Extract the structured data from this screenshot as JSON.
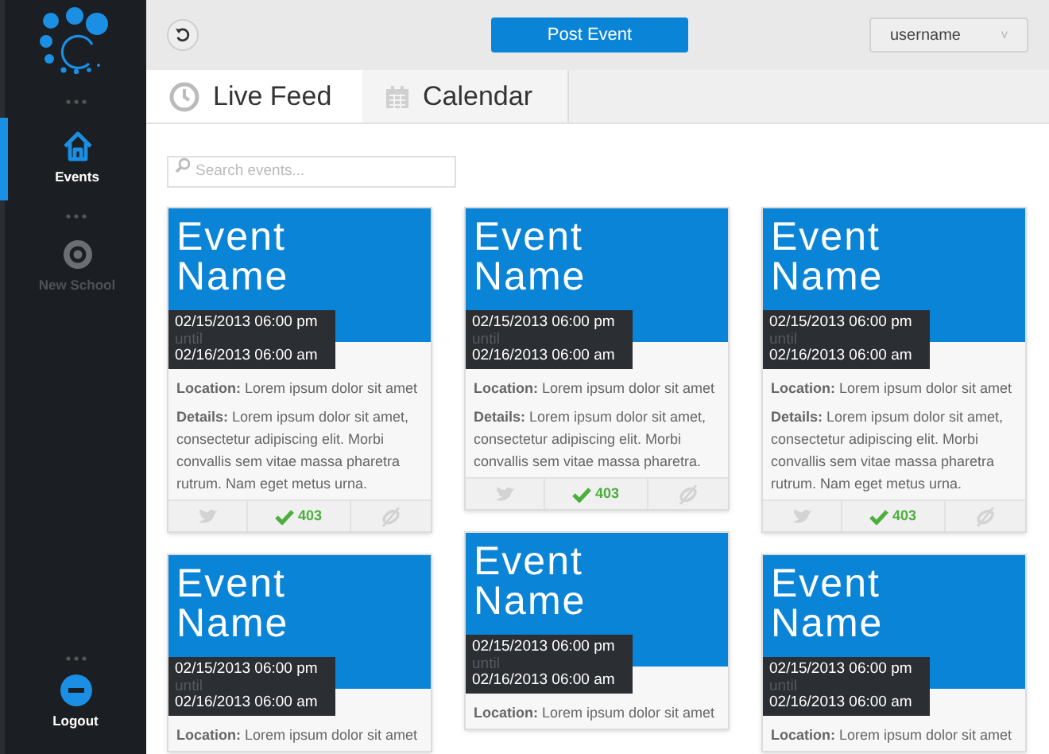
{
  "sidebar": {
    "items": [
      {
        "label": "Events",
        "kind": "home",
        "selected": true
      },
      {
        "label": "New School",
        "kind": "target",
        "selected": false
      }
    ],
    "footer_item": {
      "label": "Logout"
    }
  },
  "toolbar": {
    "post_button": "Post Event",
    "user_menu": {
      "value": "username",
      "caret": "v"
    }
  },
  "tabs": [
    {
      "label": "Live Feed",
      "kind": "clock",
      "selected": true
    },
    {
      "label": "Calendar",
      "kind": "calendar",
      "selected": false
    }
  ],
  "search": {
    "placeholder": "Search events..."
  },
  "columns": [
    {
      "cards": [
        {
          "title": "Event Name",
          "start": "02/15/2013 06:00 pm",
          "until": "until",
          "end": "02/16/2013 06:00 am",
          "body": [
            "**Location:** Lorem ipsum dolor sit amet",
            "**Details:** Lorem ipsum dolor sit amet, consectetur adipiscing elit. Morbi convallis sem vitae massa pharetra rutrum. Nam eget metus urna."
          ],
          "footer": {
            "count": "403",
            "checked": true
          }
        },
        {
          "title": "Event Name",
          "start": "02/15/2013 06:00 pm",
          "until": "until",
          "end": "02/16/2013 06:00 am",
          "body": [
            "**Location:** Lorem ipsum dolor sit amet"
          ]
        }
      ]
    },
    {
      "cards": [
        {
          "title": "Event Name",
          "start": "02/15/2013 06:00 pm",
          "until": "until",
          "end": "02/16/2013 06:00 am",
          "body": [
            "**Location:** Lorem ipsum dolor sit amet",
            "**Details:** Lorem ipsum dolor sit amet, consectetur adipiscing elit. Morbi convallis sem vitae massa pharetra."
          ],
          "footer": {
            "count": "403",
            "checked": true
          }
        },
        {
          "title": "Event Name",
          "start": "02/15/2013 06:00 pm",
          "until": "until",
          "end": "02/16/2013 06:00 am",
          "body": [
            "**Location:** Lorem ipsum dolor sit amet"
          ]
        }
      ]
    },
    {
      "cards": [
        {
          "title": "Event Name",
          "start": "02/15/2013 06:00 pm",
          "until": "until",
          "end": "02/16/2013 06:00 am",
          "body": [
            "**Location:** Lorem ipsum dolor sit amet",
            "**Details:** Lorem ipsum dolor sit amet, consectetur adipiscing elit. Morbi convallis sem vitae massa pharetra rutrum. Nam eget metus urna."
          ],
          "footer": {
            "count": "403",
            "checked": true
          }
        },
        {
          "title": "Event Name",
          "start": "02/15/2013 06:00 pm",
          "until": "until",
          "end": "02/16/2013 06:00 am",
          "body": [
            "**Location:** Lorem ipsum dolor sit amet"
          ]
        }
      ]
    }
  ]
}
